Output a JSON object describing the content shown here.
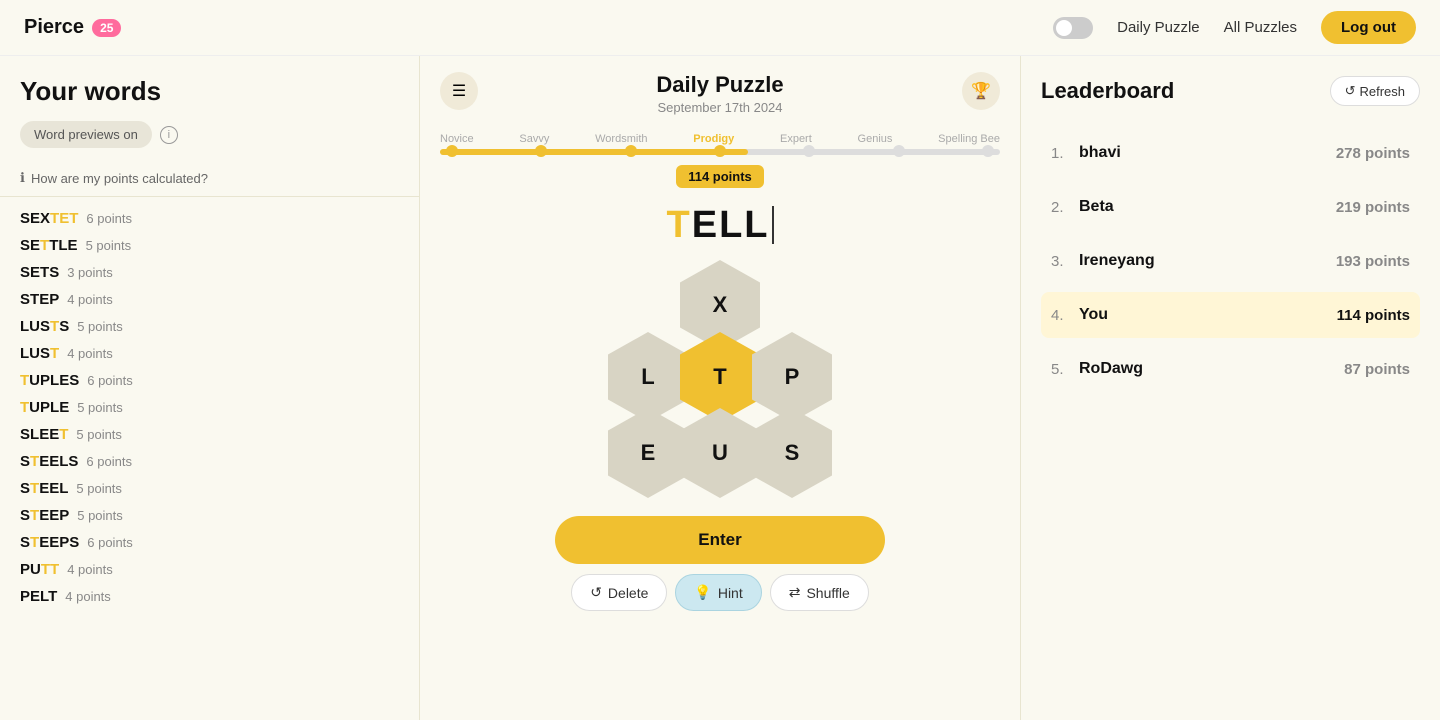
{
  "header": {
    "app_name": "Pierce",
    "badge": "25",
    "nav_daily": "Daily Puzzle",
    "nav_all": "All Puzzles",
    "logout_label": "Log out"
  },
  "left_panel": {
    "title": "Your words",
    "word_previews_label": "Word previews on",
    "info_icon": "ℹ",
    "points_calc_label": "How are my points calculated?",
    "words": [
      {
        "text": "SEXTET",
        "highlight": "T",
        "points": "6 points",
        "highlight_indices": [
          3,
          4,
          5
        ]
      },
      {
        "text": "SETTLE",
        "highlight": "T",
        "points": "5 points",
        "highlight_indices": [
          2
        ]
      },
      {
        "text": "SETS",
        "highlight": "",
        "points": "3 points",
        "highlight_indices": []
      },
      {
        "text": "STEP",
        "highlight": "",
        "points": "4 points",
        "highlight_indices": []
      },
      {
        "text": "LUSTS",
        "highlight": "T",
        "points": "5 points",
        "highlight_indices": [
          3
        ]
      },
      {
        "text": "LUST",
        "highlight": "T",
        "points": "4 points",
        "highlight_indices": [
          3
        ]
      },
      {
        "text": "TUPLES",
        "highlight": "T",
        "points": "6 points",
        "highlight_indices": [
          0
        ]
      },
      {
        "text": "TUPLE",
        "highlight": "T",
        "points": "5 points",
        "highlight_indices": [
          0
        ]
      },
      {
        "text": "SLEET",
        "highlight": "T",
        "points": "5 points",
        "highlight_indices": [
          4
        ]
      },
      {
        "text": "STEELS",
        "highlight": "T",
        "points": "6 points",
        "highlight_indices": [
          1
        ]
      },
      {
        "text": "STEEL",
        "highlight": "T",
        "points": "5 points",
        "highlight_indices": [
          1
        ]
      },
      {
        "text": "STEEP",
        "highlight": "T",
        "points": "5 points",
        "highlight_indices": [
          1
        ]
      },
      {
        "text": "STEEPS",
        "highlight": "T",
        "points": "6 points",
        "highlight_indices": [
          1
        ]
      },
      {
        "text": "PUTT",
        "highlight": "T",
        "points": "4 points",
        "highlight_indices": [
          2,
          3
        ]
      },
      {
        "text": "PELT",
        "highlight": "T",
        "points": "4 points",
        "highlight_indices": []
      }
    ]
  },
  "center": {
    "title": "Daily Puzzle",
    "date": "September 17th 2024",
    "progress_levels": [
      "Novice",
      "Savvy",
      "Wordsmith",
      "Prodigy",
      "Expert",
      "Genius",
      "Spelling Bee"
    ],
    "active_level": "Prodigy",
    "points": "114 points",
    "progress_percent": 55,
    "typing_display": "TELL",
    "center_letter": "T",
    "hex_letters": [
      "X",
      "L",
      "P",
      "E",
      "S",
      "U"
    ],
    "enter_label": "Enter",
    "delete_label": "Delete",
    "hint_label": "Hint",
    "shuffle_label": "Shuffle"
  },
  "leaderboard": {
    "title": "Leaderboard",
    "refresh_label": "Refresh",
    "entries": [
      {
        "rank": "1.",
        "name": "bhavi",
        "points": "278 points",
        "you": false
      },
      {
        "rank": "2.",
        "name": "Beta",
        "points": "219 points",
        "you": false
      },
      {
        "rank": "3.",
        "name": "Ireneyang",
        "points": "193 points",
        "you": false
      },
      {
        "rank": "4.",
        "name": "You",
        "points": "114 points",
        "you": true
      },
      {
        "rank": "5.",
        "name": "RoDawg",
        "points": "87 points",
        "you": false
      }
    ]
  }
}
